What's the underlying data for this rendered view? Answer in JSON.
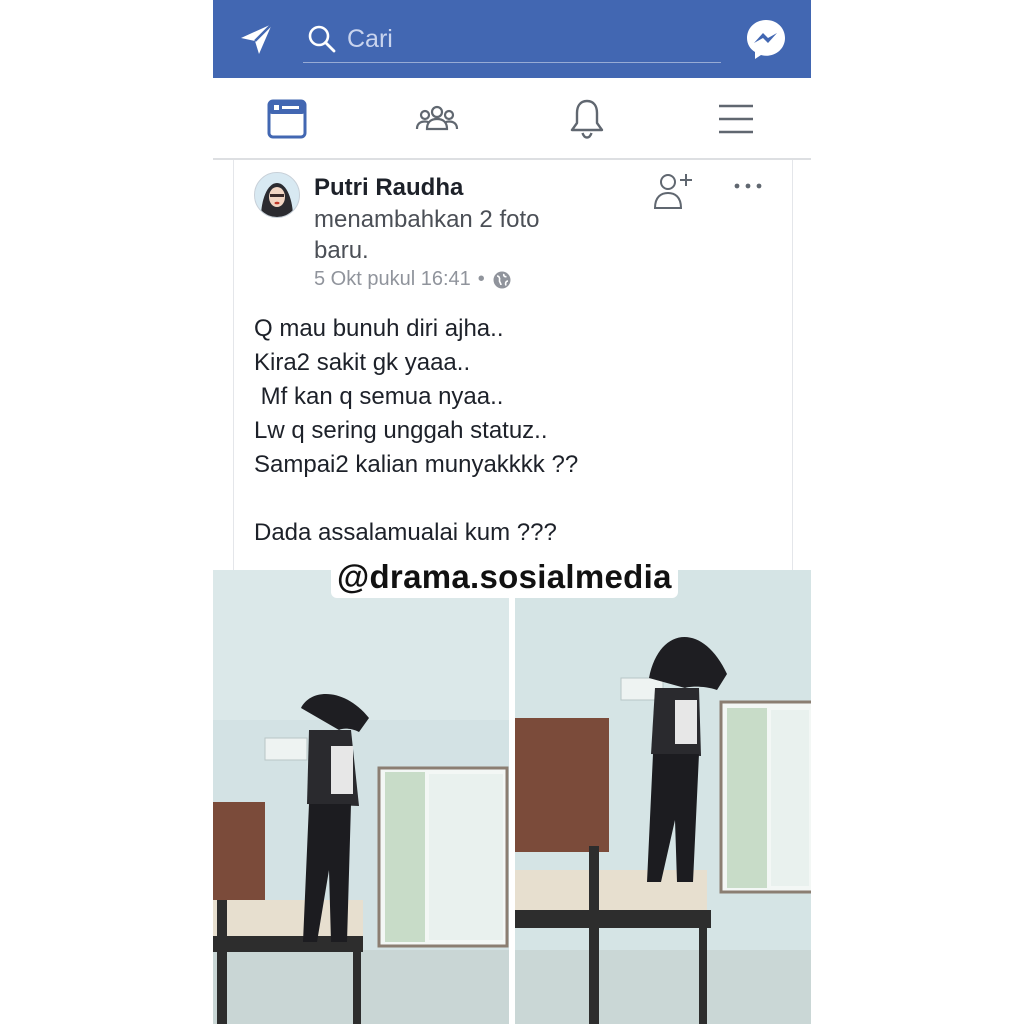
{
  "search": {
    "placeholder": "Cari"
  },
  "icons": {
    "send": "paper-plane-icon",
    "search": "search-icon",
    "messenger": "messenger-icon",
    "news_feed": "news-feed-icon",
    "friends": "friends-icon",
    "notifications": "bell-icon",
    "menu": "hamburger-menu-icon",
    "add_friend": "add-friend-icon",
    "more": "more-options-icon",
    "audience": "globe-icon"
  },
  "colors": {
    "brand": "#4267b2",
    "active_tab": "#4267b2",
    "text": "#1d2129",
    "meta": "#90949c"
  },
  "post": {
    "author": "Putri Raudha",
    "action": "menambahkan 2 foto baru.",
    "timestamp": "5 Okt pukul 16:41",
    "separator": "•",
    "lines": [
      "Q mau bunuh diri ajha..",
      "Kira2 sakit gk yaaa..",
      " Mf kan q semua nyaa..",
      "Lw q sering unggah statuz..",
      "Sampai2 kalian munyakkkk ??",
      "",
      "Dada assalamualai kum ???"
    ]
  },
  "watermark": "@drama.sosialmedia"
}
